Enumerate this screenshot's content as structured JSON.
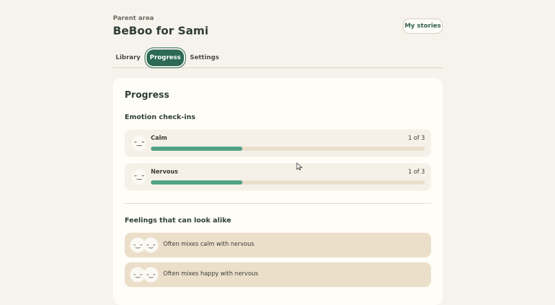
{
  "header": {
    "eyebrow": "Parent area",
    "title": "BeBoo for Sami",
    "my_stories_label": "My stories"
  },
  "tabs": [
    {
      "label": "Library",
      "active": false
    },
    {
      "label": "Progress",
      "active": true
    },
    {
      "label": "Settings",
      "active": false
    }
  ],
  "progress": {
    "title": "Progress",
    "checkins_title": "Emotion check-ins",
    "checkins": [
      {
        "face": "ᵕ‿ᵕ",
        "label": "Calm",
        "count": "1 of 3",
        "fraction": 0.333
      },
      {
        "face": "ᵕ‿ᵕ",
        "label": "Nervous",
        "count": "1 of 3",
        "fraction": 0.333
      }
    ],
    "alike_title": "Feelings that can look alike",
    "alike": [
      {
        "face_a": "ᵕ‿ᵕ",
        "face_b": "ᵕ‿ᵕ",
        "label": "Often mixes calm with nervous"
      },
      {
        "face_a": "ᵕ‿ᵕ",
        "face_b": "ᵕ‿ᵕ",
        "label": "Often mixes happy with nervous"
      }
    ]
  },
  "colors": {
    "accent": "#2c6a55",
    "bar_fill": "#4fa283",
    "bar_track": "#ebdfcb",
    "alike_bg": "#ecdfca",
    "page_bg": "#f6f3ec"
  }
}
